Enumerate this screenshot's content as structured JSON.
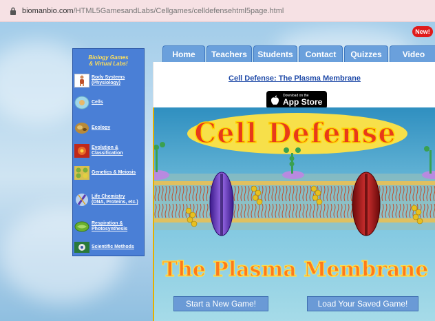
{
  "address_bar": {
    "domain": "biomanbio.com",
    "path": "/HTML5GamesandLabs/Cellgames/celldefensehtml5page.html"
  },
  "left_nav": {
    "title_line1": "Biology Games",
    "title_line2": "& Virtual Labs!",
    "items": [
      {
        "label1": "Body Systems",
        "label2": "(Physiology)",
        "icon": "body-systems-icon"
      },
      {
        "label1": "Cells",
        "label2": "",
        "icon": "cells-icon"
      },
      {
        "label1": "Ecology",
        "label2": "",
        "icon": "ecology-icon"
      },
      {
        "label1": "Evolution &",
        "label2": "Classification",
        "icon": "evolution-icon"
      },
      {
        "label1": "Genetics & Meiosis",
        "label2": "",
        "icon": "genetics-icon"
      },
      {
        "label1": "Life Chemistry",
        "label2": "(DNA, Proteins, etc.)",
        "icon": "dna-icon"
      },
      {
        "label1": "Respiration &",
        "label2": "Photosynthesis",
        "icon": "chloroplast-icon"
      },
      {
        "label1": "Scientific Methods",
        "label2": "",
        "icon": "scientific-methods-icon"
      }
    ]
  },
  "tabs": [
    "Home",
    "Teachers",
    "Students",
    "Contact",
    "Quizzes",
    "Video"
  ],
  "new_badge": "New!",
  "page_link": "Cell Defense: The Plasma Membrane",
  "app_store": {
    "small": "Download on the",
    "big": "App Store"
  },
  "game": {
    "title": "Cell Defense",
    "subtitle": "The Plasma Membrane",
    "start_button": "Start a New Game!",
    "load_button": "Load Your Saved Game!"
  },
  "colors": {
    "nav_bg": "#4a7fd6",
    "nav_title": "#ffe05a",
    "tab_bg": "#6aa0dc",
    "link": "#1f4aa8",
    "game_title": "#e83a1a",
    "game_title_outline": "#ffd400",
    "badge": "#e01b1b"
  }
}
